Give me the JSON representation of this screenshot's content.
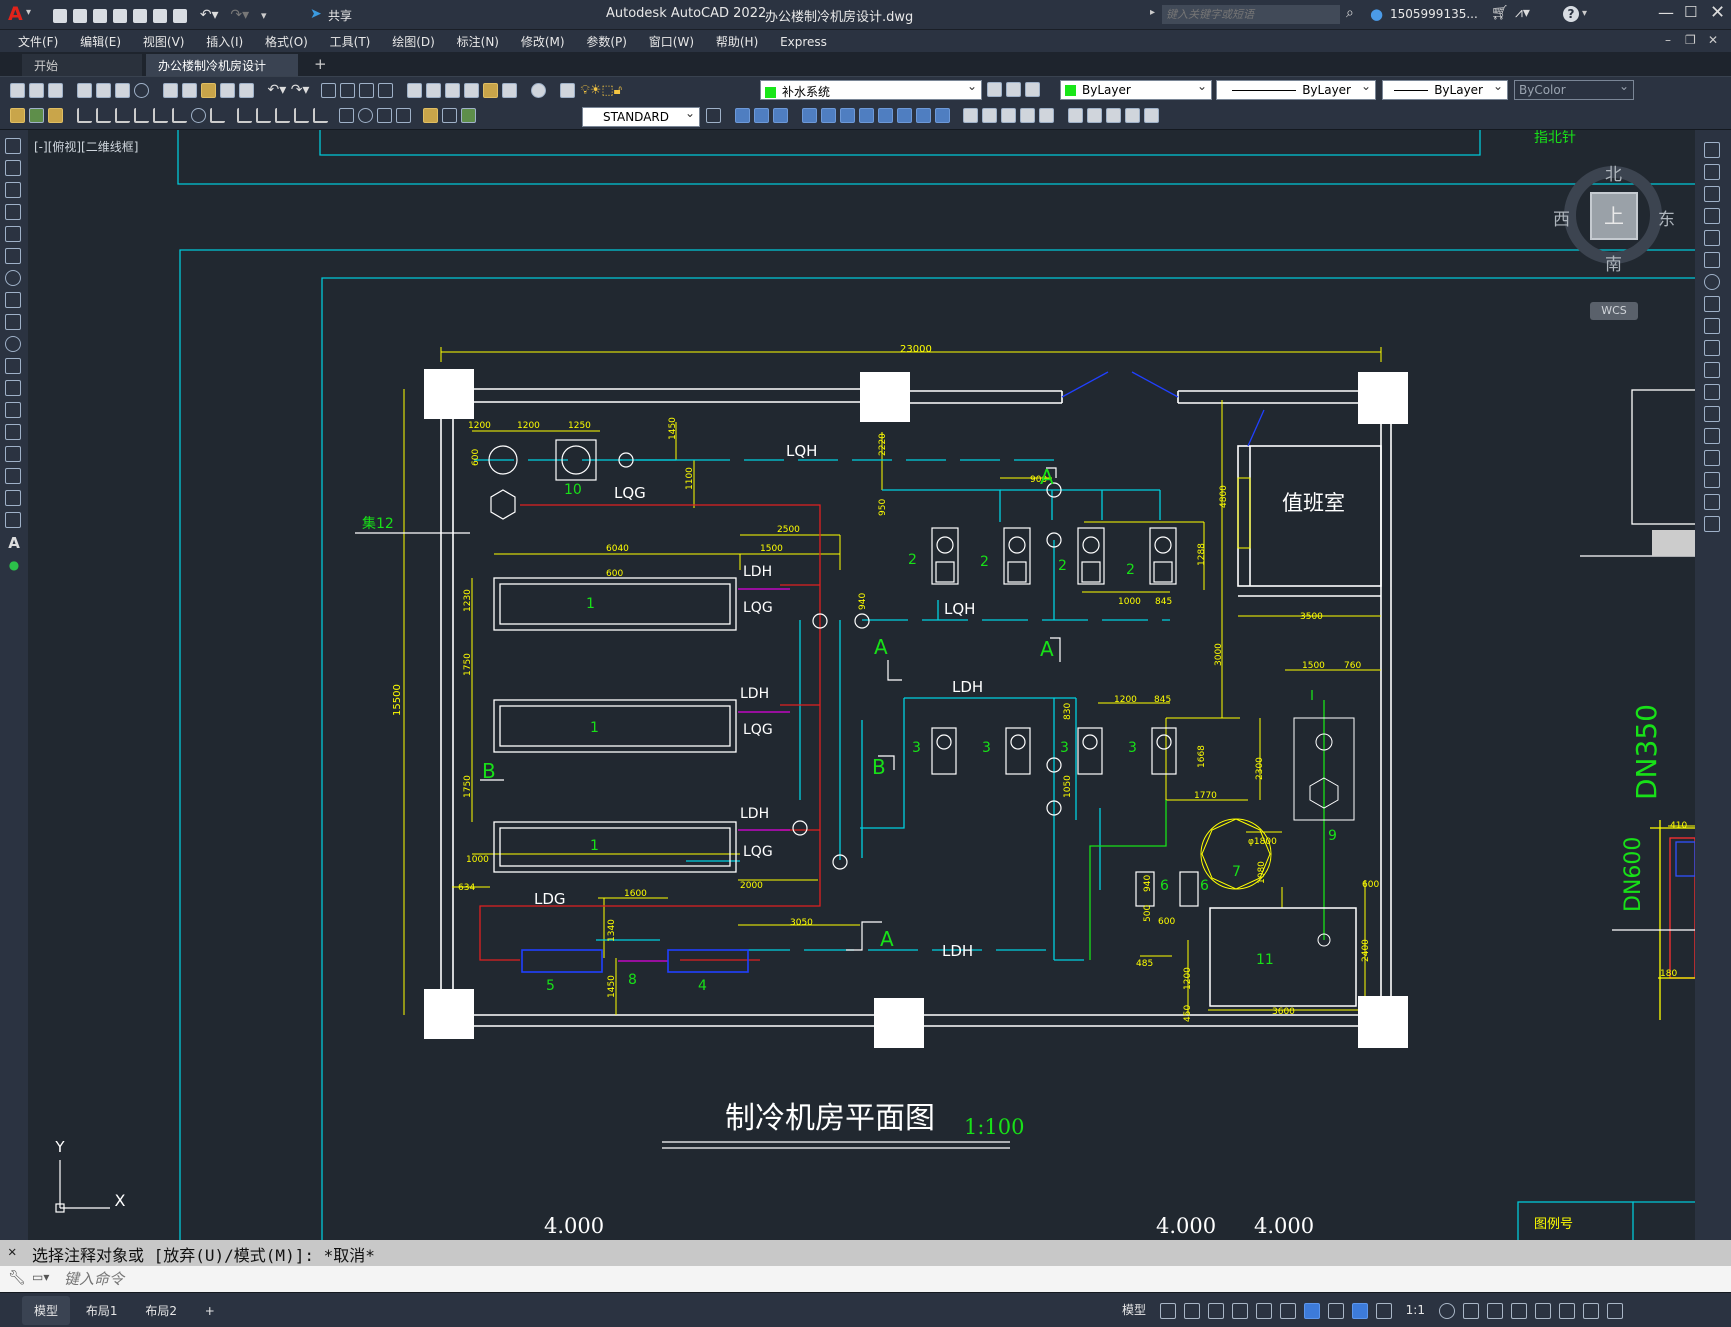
{
  "app": {
    "logo": "A",
    "title": "Autodesk AutoCAD 2022",
    "file": "办公楼制冷机房设计.dwg",
    "share": "共享",
    "search_placeholder": "键入关键字或短语",
    "user": "1505999135...",
    "help": "?"
  },
  "menu": [
    "文件(F)",
    "编辑(E)",
    "视图(V)",
    "插入(I)",
    "格式(O)",
    "工具(T)",
    "绘图(D)",
    "标注(N)",
    "修改(M)",
    "参数(P)",
    "窗口(W)",
    "帮助(H)",
    "Express"
  ],
  "tabs": {
    "start": "开始",
    "active": "办公楼制冷机房设计*",
    "close": "×",
    "add": "+"
  },
  "toolbar1": {
    "layer": "补水系统",
    "color": "ByLayer",
    "linetype": "ByLayer",
    "lineweight": "ByLayer",
    "plotstyle": "ByColor"
  },
  "toolbar2": {
    "textstyle": "STANDARD"
  },
  "viewport": {
    "label": "[-][俯视][二维线框]",
    "wcs": "WCS",
    "compass": {
      "n": "北",
      "s": "南",
      "e": "东",
      "w": "西",
      "top": "上"
    }
  },
  "drawing": {
    "title": "制冷机房平面图",
    "scale": "1:100",
    "elev_left": "4.000",
    "elev_mid1": "4.000",
    "elev_mid2": "4.000",
    "room": "值班室",
    "legend_cell": "图例号",
    "top_cell": "指北针",
    "dn350": "DN350",
    "dn600": "DN600",
    "dims": {
      "d23000": "23000",
      "d15500": "15500",
      "d6040": "6040",
      "d2500": "2500",
      "d1500": "1500",
      "d1250": "1250",
      "d1200": "1200",
      "d600": "600",
      "d1450": "1450",
      "d1100": "1100",
      "d2220": "2220",
      "d950": "950",
      "d900": "900",
      "d4800": "4800",
      "d1288": "1288",
      "d1000": "1000",
      "d845": "845",
      "d940": "940",
      "d1750": "1750",
      "d1230": "1230",
      "d3500": "3500",
      "d3000": "3000",
      "d1500b": "1500",
      "d760": "760",
      "d1200b": "1200",
      "d845b": "845",
      "d1668": "1668",
      "d830": "830",
      "d1050": "1050",
      "d2300": "2300",
      "d1770": "1770",
      "d1800": "φ1800",
      "d1080": "1080",
      "d600b": "600",
      "d2400": "2400",
      "d3600": "3600",
      "d1200c": "1200",
      "d450": "450",
      "d485": "485",
      "d600c": "600",
      "d500": "500",
      "d940b": "940",
      "d634": "634",
      "d1000b": "1000",
      "d2000": "2000",
      "d3050": "3050",
      "d1600": "1600",
      "d1340": "1340",
      "d1450b": "1450",
      "d410": "410",
      "d180": "180"
    },
    "pipes": {
      "LQH": "LQH",
      "LQG": "LQG",
      "LDH": "LDH",
      "LDG": "LDG"
    },
    "marks": {
      "A": "A",
      "B": "B"
    },
    "nums": {
      "n1": "1",
      "n2": "2",
      "n3": "3",
      "n4": "4",
      "n5": "5",
      "n6": "6",
      "n7": "7",
      "n8": "8",
      "n9": "9",
      "n10": "10",
      "n11": "11",
      "n12": "集12"
    }
  },
  "command": {
    "history": "选择注释对象或 [放弃(U)/模式(M)]: *取消*",
    "placeholder": "键入命令"
  },
  "layouts": [
    "模型",
    "布局1",
    "布局2"
  ],
  "status": {
    "model": "模型",
    "scale": "1:1"
  }
}
